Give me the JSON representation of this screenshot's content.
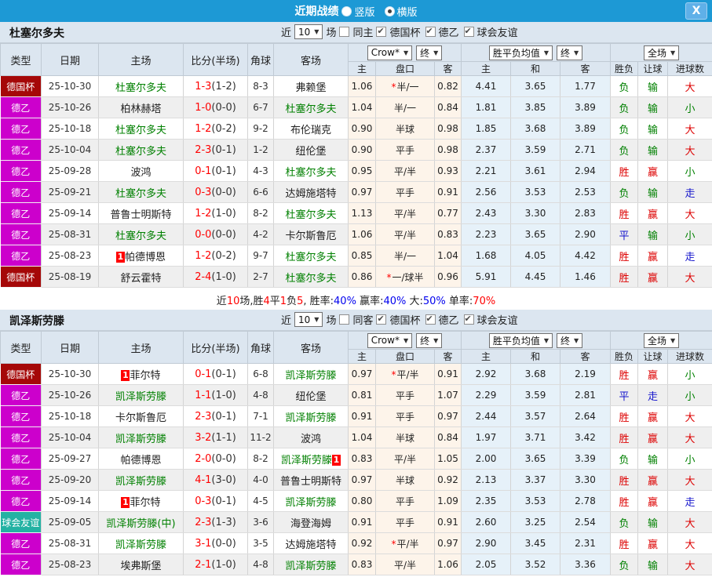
{
  "topbar": {
    "title": "近期战绩",
    "radio_vertical": "竖版",
    "radio_horizontal": "横版",
    "close_icon": "X"
  },
  "filter_labels": {
    "near": "近",
    "count": "10",
    "unit": "场"
  },
  "columns": {
    "type": "类型",
    "date": "日期",
    "home": "主场",
    "score": "比分(半场)",
    "corner": "角球",
    "away": "客场",
    "crow_select": "Crow*",
    "final_select": "终",
    "avg_select": "胜平负均值",
    "full_select": "全场",
    "odds_home": "主",
    "handicap": "盘口",
    "odds_away": "客",
    "avg_home": "主",
    "avg_draw": "和",
    "avg_away": "客",
    "wdl": "胜负",
    "let_ball": "让球",
    "goals": "进球数"
  },
  "type_colors": {
    "德国杯": "#a50808",
    "德乙": "#cc00cc",
    "球会友谊": "#23b2a3"
  },
  "result_colors": {
    "胜": "#dd0000",
    "赢": "#dd0000",
    "大": "#dd0000",
    "负": "#008000",
    "输": "#008000",
    "小": "#008000",
    "平": "#1515cc",
    "走": "#1515cc"
  },
  "sections": [
    {
      "team": "杜塞尔多夫",
      "filter": {
        "same": "同主",
        "comps": [
          "德国杯",
          "德乙",
          "球会友谊"
        ]
      },
      "rows": [
        {
          "type": "德国杯",
          "date": "25-10-30",
          "home": "杜塞尔多夫",
          "hg": 1,
          "hb": 0,
          "score": "1-3",
          "half": "(1-2)",
          "corner": "8-3",
          "away": "弗赖堡",
          "ag": 0,
          "ab": 0,
          "o1": "1.06",
          "st": 1,
          "hc": "半/一",
          "o2": "0.82",
          "m1": "4.41",
          "m2": "3.65",
          "m3": "1.77",
          "r1": "负",
          "r2": "输",
          "r3": "大"
        },
        {
          "type": "德乙",
          "date": "25-10-26",
          "home": "柏林赫塔",
          "hg": 0,
          "hb": 0,
          "score": "1-0",
          "half": "(0-0)",
          "corner": "6-7",
          "away": "杜塞尔多夫",
          "ag": 1,
          "ab": 0,
          "o1": "1.04",
          "st": 0,
          "hc": "半/一",
          "o2": "0.84",
          "m1": "1.81",
          "m2": "3.85",
          "m3": "3.89",
          "r1": "负",
          "r2": "输",
          "r3": "小"
        },
        {
          "type": "德乙",
          "date": "25-10-18",
          "home": "杜塞尔多夫",
          "hg": 1,
          "hb": 0,
          "score": "1-2",
          "half": "(0-2)",
          "corner": "9-2",
          "away": "布伦瑞克",
          "ag": 0,
          "ab": 0,
          "o1": "0.90",
          "st": 0,
          "hc": "半球",
          "o2": "0.98",
          "m1": "1.85",
          "m2": "3.68",
          "m3": "3.89",
          "r1": "负",
          "r2": "输",
          "r3": "大"
        },
        {
          "type": "德乙",
          "date": "25-10-04",
          "home": "杜塞尔多夫",
          "hg": 1,
          "hb": 0,
          "score": "2-3",
          "half": "(0-1)",
          "corner": "1-2",
          "away": "纽伦堡",
          "ag": 0,
          "ab": 0,
          "o1": "0.90",
          "st": 0,
          "hc": "平手",
          "o2": "0.98",
          "m1": "2.37",
          "m2": "3.59",
          "m3": "2.71",
          "r1": "负",
          "r2": "输",
          "r3": "大"
        },
        {
          "type": "德乙",
          "date": "25-09-28",
          "home": "波鸿",
          "hg": 0,
          "hb": 0,
          "score": "0-1",
          "half": "(0-1)",
          "corner": "4-3",
          "away": "杜塞尔多夫",
          "ag": 1,
          "ab": 0,
          "o1": "0.95",
          "st": 0,
          "hc": "平/半",
          "o2": "0.93",
          "m1": "2.21",
          "m2": "3.61",
          "m3": "2.94",
          "r1": "胜",
          "r2": "赢",
          "r3": "小"
        },
        {
          "type": "德乙",
          "date": "25-09-21",
          "home": "杜塞尔多夫",
          "hg": 1,
          "hb": 0,
          "score": "0-3",
          "half": "(0-0)",
          "corner": "6-6",
          "away": "达姆施塔特",
          "ag": 0,
          "ab": 0,
          "o1": "0.97",
          "st": 0,
          "hc": "平手",
          "o2": "0.91",
          "m1": "2.56",
          "m2": "3.53",
          "m3": "2.53",
          "r1": "负",
          "r2": "输",
          "r3": "走"
        },
        {
          "type": "德乙",
          "date": "25-09-14",
          "home": "普鲁士明斯特",
          "hg": 0,
          "hb": 0,
          "score": "1-2",
          "half": "(1-0)",
          "corner": "8-2",
          "away": "杜塞尔多夫",
          "ag": 1,
          "ab": 0,
          "o1": "1.13",
          "st": 0,
          "hc": "平/半",
          "o2": "0.77",
          "m1": "2.43",
          "m2": "3.30",
          "m3": "2.83",
          "r1": "胜",
          "r2": "赢",
          "r3": "大"
        },
        {
          "type": "德乙",
          "date": "25-08-31",
          "home": "杜塞尔多夫",
          "hg": 1,
          "hb": 0,
          "score": "0-0",
          "half": "(0-0)",
          "corner": "4-2",
          "away": "卡尔斯鲁厄",
          "ag": 0,
          "ab": 0,
          "o1": "1.06",
          "st": 0,
          "hc": "平/半",
          "o2": "0.83",
          "m1": "2.23",
          "m2": "3.65",
          "m3": "2.90",
          "r1": "平",
          "r2": "输",
          "r3": "小"
        },
        {
          "type": "德乙",
          "date": "25-08-23",
          "home": "帕德博恩",
          "hg": 0,
          "hb": 1,
          "score": "1-2",
          "half": "(0-2)",
          "corner": "9-7",
          "away": "杜塞尔多夫",
          "ag": 1,
          "ab": 0,
          "o1": "0.85",
          "st": 0,
          "hc": "半/一",
          "o2": "1.04",
          "m1": "1.68",
          "m2": "4.05",
          "m3": "4.42",
          "r1": "胜",
          "r2": "赢",
          "r3": "走"
        },
        {
          "type": "德国杯",
          "date": "25-08-19",
          "home": "舒云霍特",
          "hg": 0,
          "hb": 0,
          "score": "2-4",
          "half": "(1-0)",
          "corner": "2-7",
          "away": "杜塞尔多夫",
          "ag": 1,
          "ab": 0,
          "o1": "0.86",
          "st": 1,
          "hc": "一/球半",
          "o2": "0.96",
          "m1": "5.91",
          "m2": "4.45",
          "m3": "1.46",
          "r1": "胜",
          "r2": "赢",
          "r3": "大"
        }
      ],
      "summary": [
        {
          "t": "近",
          "c": "k"
        },
        {
          "t": "10",
          "c": "r"
        },
        {
          "t": "场,胜",
          "c": "k"
        },
        {
          "t": "4",
          "c": "r"
        },
        {
          "t": "平",
          "c": "k"
        },
        {
          "t": "1",
          "c": "r"
        },
        {
          "t": "负",
          "c": "k"
        },
        {
          "t": "5",
          "c": "r"
        },
        {
          "t": ", 胜率:",
          "c": "k"
        },
        {
          "t": "40%",
          "c": "b"
        },
        {
          "t": " 赢率:",
          "c": "k"
        },
        {
          "t": "40%",
          "c": "b"
        },
        {
          "t": " 大:",
          "c": "k"
        },
        {
          "t": "50%",
          "c": "b"
        },
        {
          "t": " 单率:",
          "c": "k"
        },
        {
          "t": "70%",
          "c": "r"
        }
      ]
    },
    {
      "team": "凯泽斯劳滕",
      "filter": {
        "same": "同客",
        "comps": [
          "德国杯",
          "德乙",
          "球会友谊"
        ]
      },
      "rows": [
        {
          "type": "德国杯",
          "date": "25-10-30",
          "home": "菲尔特",
          "hg": 0,
          "hb": 1,
          "score": "0-1",
          "half": "(0-1)",
          "corner": "6-8",
          "away": "凯泽斯劳滕",
          "ag": 1,
          "ab": 0,
          "o1": "0.97",
          "st": 1,
          "hc": "平/半",
          "o2": "0.91",
          "m1": "2.92",
          "m2": "3.68",
          "m3": "2.19",
          "r1": "胜",
          "r2": "赢",
          "r3": "小"
        },
        {
          "type": "德乙",
          "date": "25-10-26",
          "home": "凯泽斯劳滕",
          "hg": 1,
          "hb": 0,
          "score": "1-1",
          "half": "(1-0)",
          "corner": "4-8",
          "away": "纽伦堡",
          "ag": 0,
          "ab": 0,
          "o1": "0.81",
          "st": 0,
          "hc": "平手",
          "o2": "1.07",
          "m1": "2.29",
          "m2": "3.59",
          "m3": "2.81",
          "r1": "平",
          "r2": "走",
          "r3": "小"
        },
        {
          "type": "德乙",
          "date": "25-10-18",
          "home": "卡尔斯鲁厄",
          "hg": 0,
          "hb": 0,
          "score": "2-3",
          "half": "(0-1)",
          "corner": "7-1",
          "away": "凯泽斯劳滕",
          "ag": 1,
          "ab": 0,
          "o1": "0.91",
          "st": 0,
          "hc": "平手",
          "o2": "0.97",
          "m1": "2.44",
          "m2": "3.57",
          "m3": "2.64",
          "r1": "胜",
          "r2": "赢",
          "r3": "大"
        },
        {
          "type": "德乙",
          "date": "25-10-04",
          "home": "凯泽斯劳滕",
          "hg": 1,
          "hb": 0,
          "score": "3-2",
          "half": "(1-1)",
          "corner": "11-2",
          "away": "波鸿",
          "ag": 0,
          "ab": 0,
          "o1": "1.04",
          "st": 0,
          "hc": "半球",
          "o2": "0.84",
          "m1": "1.97",
          "m2": "3.71",
          "m3": "3.42",
          "r1": "胜",
          "r2": "赢",
          "r3": "大"
        },
        {
          "type": "德乙",
          "date": "25-09-27",
          "home": "帕德博恩",
          "hg": 0,
          "hb": 0,
          "score": "2-0",
          "half": "(0-0)",
          "corner": "8-2",
          "away": "凯泽斯劳滕",
          "ag": 1,
          "ab": 1,
          "o1": "0.83",
          "st": 0,
          "hc": "平/半",
          "o2": "1.05",
          "m1": "2.00",
          "m2": "3.65",
          "m3": "3.39",
          "r1": "负",
          "r2": "输",
          "r3": "小"
        },
        {
          "type": "德乙",
          "date": "25-09-20",
          "home": "凯泽斯劳滕",
          "hg": 1,
          "hb": 0,
          "score": "4-1",
          "half": "(3-0)",
          "corner": "4-0",
          "away": "普鲁士明斯特",
          "ag": 0,
          "ab": 0,
          "o1": "0.97",
          "st": 0,
          "hc": "半球",
          "o2": "0.92",
          "m1": "2.13",
          "m2": "3.37",
          "m3": "3.30",
          "r1": "胜",
          "r2": "赢",
          "r3": "大"
        },
        {
          "type": "德乙",
          "date": "25-09-14",
          "home": "菲尔特",
          "hg": 0,
          "hb": 1,
          "score": "0-3",
          "half": "(0-1)",
          "corner": "4-5",
          "away": "凯泽斯劳滕",
          "ag": 1,
          "ab": 0,
          "o1": "0.80",
          "st": 0,
          "hc": "平手",
          "o2": "1.09",
          "m1": "2.35",
          "m2": "3.53",
          "m3": "2.78",
          "r1": "胜",
          "r2": "赢",
          "r3": "走"
        },
        {
          "type": "球会友谊",
          "date": "25-09-05",
          "home": "凯泽斯劳滕(中)",
          "hg": 1,
          "hb": 0,
          "score": "2-3",
          "half": "(1-3)",
          "corner": "3-6",
          "away": "海登海姆",
          "ag": 0,
          "ab": 0,
          "o1": "0.91",
          "st": 0,
          "hc": "平手",
          "o2": "0.91",
          "m1": "2.60",
          "m2": "3.25",
          "m3": "2.54",
          "r1": "负",
          "r2": "输",
          "r3": "大"
        },
        {
          "type": "德乙",
          "date": "25-08-31",
          "home": "凯泽斯劳滕",
          "hg": 1,
          "hb": 0,
          "score": "3-1",
          "half": "(0-0)",
          "corner": "3-5",
          "away": "达姆施塔特",
          "ag": 0,
          "ab": 0,
          "o1": "0.92",
          "st": 1,
          "hc": "平/半",
          "o2": "0.97",
          "m1": "2.90",
          "m2": "3.45",
          "m3": "2.31",
          "r1": "胜",
          "r2": "赢",
          "r3": "大"
        },
        {
          "type": "德乙",
          "date": "25-08-23",
          "home": "埃弗斯堡",
          "hg": 0,
          "hb": 0,
          "score": "2-1",
          "half": "(1-0)",
          "corner": "4-8",
          "away": "凯泽斯劳滕",
          "ag": 1,
          "ab": 0,
          "o1": "0.83",
          "st": 0,
          "hc": "平/半",
          "o2": "1.06",
          "m1": "2.05",
          "m2": "3.52",
          "m3": "3.36",
          "r1": "负",
          "r2": "输",
          "r3": "大"
        }
      ]
    }
  ]
}
